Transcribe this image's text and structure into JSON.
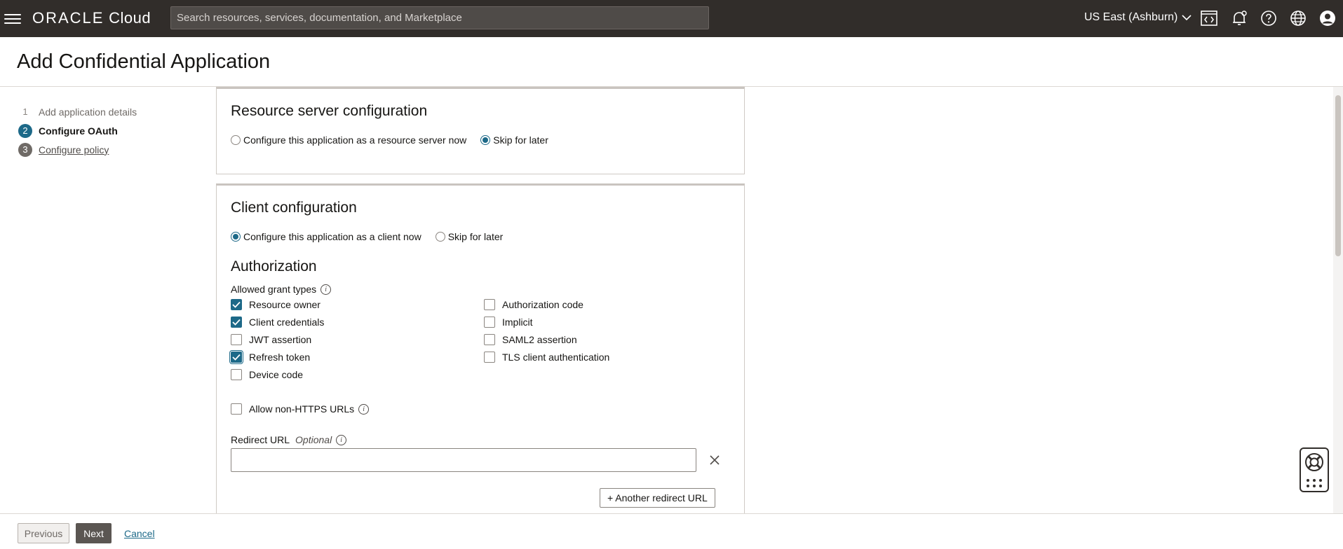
{
  "topbar": {
    "logo_brand": "ORACLE",
    "logo_product": "Cloud",
    "search_placeholder": "Search resources, services, documentation, and Marketplace",
    "region": "US East (Ashburn)"
  },
  "header": {
    "title": "Add Confidential Application"
  },
  "steps": [
    {
      "number": "1",
      "label": "Add application details"
    },
    {
      "number": "2",
      "label": "Configure OAuth"
    },
    {
      "number": "3",
      "label": "Configure policy"
    }
  ],
  "resource_server": {
    "title": "Resource server configuration",
    "option_now": "Configure this application as a resource server now",
    "option_later": "Skip for later",
    "selected": "later"
  },
  "client": {
    "title": "Client configuration",
    "option_now": "Configure this application as a client now",
    "option_later": "Skip for later",
    "selected": "now",
    "authorization": {
      "title": "Authorization",
      "grant_types_label": "Allowed grant types",
      "grants_left": [
        {
          "label": "Resource owner",
          "checked": true
        },
        {
          "label": "Client credentials",
          "checked": true
        },
        {
          "label": "JWT assertion",
          "checked": false
        },
        {
          "label": "Refresh token",
          "checked": true
        },
        {
          "label": "Device code",
          "checked": false
        }
      ],
      "grants_right": [
        {
          "label": "Authorization code",
          "checked": false
        },
        {
          "label": "Implicit",
          "checked": false
        },
        {
          "label": "SAML2 assertion",
          "checked": false
        },
        {
          "label": "TLS client authentication",
          "checked": false
        }
      ],
      "allow_non_https_label": "Allow non-HTTPS URLs",
      "allow_non_https_checked": false,
      "redirect_url_label": "Redirect URL",
      "redirect_url_optional": "Optional",
      "redirect_url_value": "",
      "another_redirect_label": "+ Another redirect URL"
    }
  },
  "footer": {
    "previous_label": "Previous",
    "next_label": "Next",
    "cancel_label": "Cancel"
  },
  "colors": {
    "topbar_bg": "#312d2a",
    "accent": "#1d6988",
    "next_button": "#5b5652"
  },
  "icons": [
    "hamburger-icon",
    "code-editor-icon",
    "bell-icon",
    "help-icon",
    "globe-icon",
    "user-icon",
    "info-icon",
    "close-icon",
    "check-icon",
    "chevron-down-icon",
    "lifebuoy-icon",
    "grid-icon"
  ]
}
